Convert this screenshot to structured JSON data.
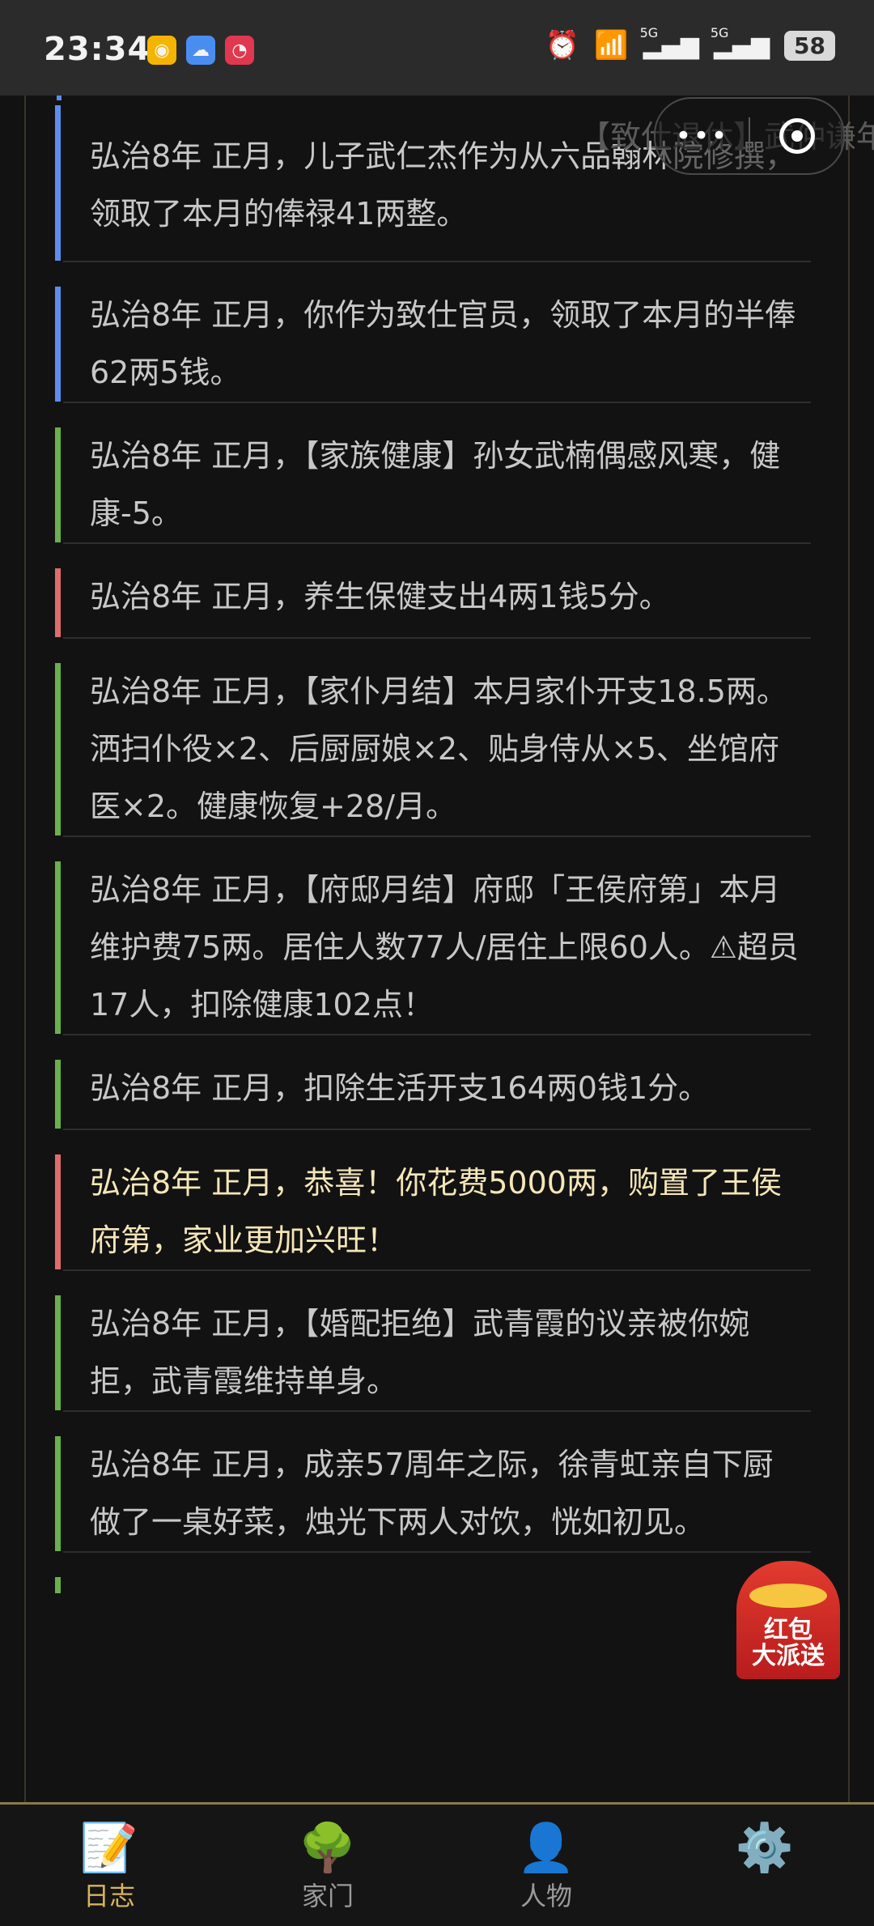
{
  "status_bar": {
    "time": "23:34",
    "battery": "58",
    "net1": "5G",
    "net2": "5G"
  },
  "capsule": {
    "more_label": "•••",
    "ghost_title": "【致仕退休】武仲谦年"
  },
  "log": {
    "entries": [
      {
        "text": "弘治8年 正月，儿子武仁杰作为从六品翰林院修撰，领取了本月的俸禄41两整。",
        "tone": "blue"
      },
      {
        "text": "弘治8年 正月，你作为致仕官员，领取了本月的半俸62两5钱。",
        "tone": "blue"
      },
      {
        "text": "弘治8年 正月，【家族健康】孙女武楠偶感风寒，健康-5。",
        "tone": "green"
      },
      {
        "text": "弘治8年 正月，养生保健支出4两1钱5分。",
        "tone": "red"
      },
      {
        "text": "弘治8年 正月，【家仆月结】本月家仆开支18.5两。洒扫仆役×2、后厨厨娘×2、贴身侍从×5、坐馆府医×2。健康恢复+28/月。",
        "tone": "green"
      },
      {
        "text": "弘治8年 正月，【府邸月结】府邸「王侯府第」本月维护费75两。居住人数77人/居住上限60人。⚠超员17人，扣除健康102点！",
        "tone": "green"
      },
      {
        "text": "弘治8年 正月，扣除生活开支164两0钱1分。",
        "tone": "green"
      },
      {
        "text": "弘治8年 正月，恭喜！你花费5000两，购置了王侯府第，家业更加兴旺！",
        "tone": "red"
      },
      {
        "text": "弘治8年 正月，【婚配拒绝】武青霞的议亲被你婉拒，武青霞维持单身。",
        "tone": "green"
      },
      {
        "text": "弘治8年 正月，成亲57周年之际，徐青虹亲自下厨做了一桌好菜，烛光下两人对饮，恍如初见。",
        "tone": "green"
      }
    ]
  },
  "red_packet": {
    "line1": "红包",
    "line2": "大派送"
  },
  "nav": {
    "items": [
      {
        "label": "日志",
        "icon": "📝",
        "active": true
      },
      {
        "label": "家门",
        "icon": "🌳",
        "active": false
      },
      {
        "label": "人物",
        "icon": "👤",
        "active": false
      },
      {
        "label": "",
        "icon": "⚙️",
        "active": false
      }
    ]
  },
  "colors": {
    "accent_blue": "#5b8def",
    "accent_green": "#6ab04c",
    "accent_red": "#e06c6c",
    "active_tab": "#d6b45a"
  }
}
